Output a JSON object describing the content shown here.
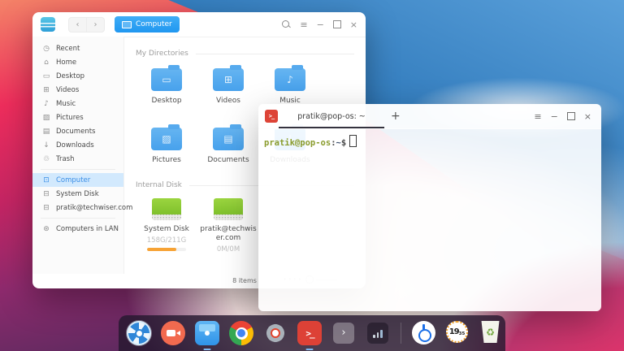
{
  "colors": {
    "fm_accent_blue": "#2b9cf2",
    "sidebar_selected_bg": "#d2e9fd",
    "folder_blue": "#47a1ec",
    "disk_green": "#8ac934",
    "progress_orange": "#f7a335",
    "terminal_red": "#dd4136",
    "prompt_green": "#8a9c2d",
    "dock_bg": "#261830",
    "clock_orange": "#f0a028"
  },
  "file_manager": {
    "nav": {
      "back": "‹",
      "forward": "›"
    },
    "location_tab": {
      "label": "Computer"
    },
    "window_controls": {
      "menu": "≡",
      "minimize": "−",
      "close": "×"
    },
    "sidebar": {
      "items": [
        {
          "icon": "◷",
          "label": "Recent"
        },
        {
          "icon": "⌂",
          "label": "Home"
        },
        {
          "icon": "▭",
          "label": "Desktop"
        },
        {
          "icon": "⊞",
          "label": "Videos"
        },
        {
          "icon": "♪",
          "label": "Music"
        },
        {
          "icon": "▨",
          "label": "Pictures"
        },
        {
          "icon": "▤",
          "label": "Documents"
        },
        {
          "icon": "↓",
          "label": "Downloads"
        },
        {
          "icon": "♲",
          "label": "Trash"
        },
        {
          "icon": "⊡",
          "label": "Computer"
        },
        {
          "icon": "⊟",
          "label": "System Disk"
        },
        {
          "icon": "⊟",
          "label": "pratik@techwiser.com"
        },
        {
          "icon": "⊛",
          "label": "Computers in LAN"
        }
      ]
    },
    "sections": {
      "my_directories": {
        "title": "My Directories",
        "folders": [
          {
            "label": "Desktop",
            "glyph": "▭"
          },
          {
            "label": "Videos",
            "glyph": "⊞"
          },
          {
            "label": "Music",
            "glyph": "♪"
          },
          {
            "label": "Pictures",
            "glyph": "▨"
          },
          {
            "label": "Documents",
            "glyph": "▤"
          },
          {
            "label": "Downloads",
            "glyph": "↓"
          }
        ]
      },
      "internal_disk": {
        "title": "Internal Disk",
        "disks": [
          {
            "name": "System Disk",
            "usage": "158G/211G",
            "progress_style": "width:75%"
          },
          {
            "name": "pratik@techwiser.com",
            "usage": "0M/0M",
            "progress_style": "width:0%"
          }
        ]
      }
    },
    "status_bar": {
      "items_count": "8 items"
    }
  },
  "terminal": {
    "icon_glyph": ">_",
    "tab_title": "pratik@pop-os: ~",
    "new_tab": "+",
    "window_controls": {
      "menu": "≡",
      "minimize": "−",
      "close": "×"
    },
    "prompt": {
      "user_host": "pratik@pop-os",
      "separator": ":",
      "path": "~",
      "symbol": "$"
    }
  },
  "dock": {
    "expander": "›",
    "trash_glyph": "♻",
    "clock": {
      "hours": "19",
      "minutes": "35"
    },
    "items": [
      "launcher",
      "screen-recorder",
      "file-manager",
      "chrome",
      "settings",
      "terminal",
      "tray-expander",
      "network-signal",
      "power",
      "clock",
      "trash"
    ]
  }
}
